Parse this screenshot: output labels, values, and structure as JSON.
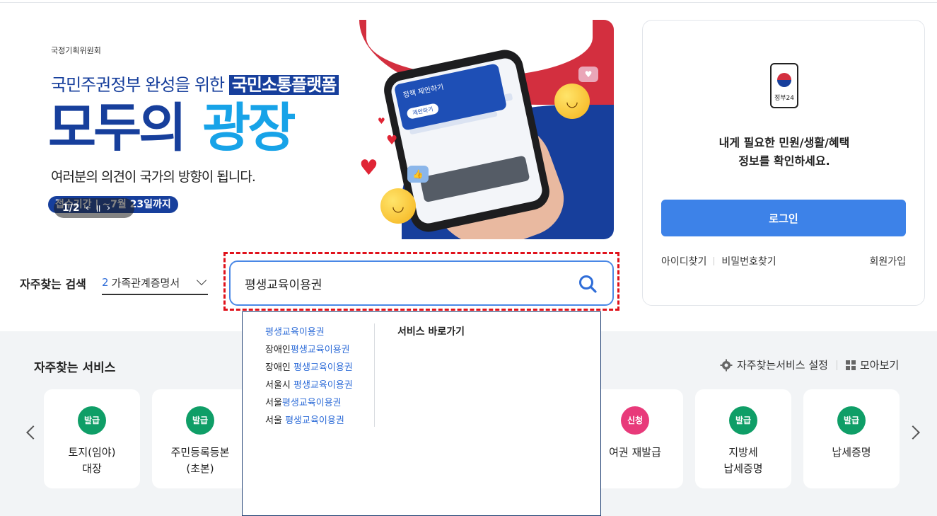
{
  "banner": {
    "org": "국정기획위원회",
    "line1_pre": "국민주권정부 완성을 위한 ",
    "line1_hl": "국민소통플랫폼",
    "big_a": "모두의",
    "big_b": "광장",
    "sub": "여러분의 의견이 국가의 방향이 됩니다.",
    "period": "접수기간 | ~7월 23일까지",
    "pager": "1/2",
    "card_title": "정책 제안하기",
    "card_button": "제안하기"
  },
  "login": {
    "logo_label": "정부24",
    "message_line1": "내게 필요한 민원/생활/혜택",
    "message_line2": "정보를 확인하세요.",
    "login_button": "로그인",
    "find_id": "아이디찾기",
    "find_pw": "비밀번호찾기",
    "signup": "회원가입"
  },
  "search": {
    "fav_label": "자주찾는 검색",
    "fav_rank": "2",
    "fav_term": "가족관계증명서",
    "query": "평생교육이용권"
  },
  "suggestions": {
    "items": [
      {
        "pre": "",
        "match": "평생교육이용권"
      },
      {
        "pre": "장애인",
        "match": "평생교육이용권"
      },
      {
        "pre": "장애인 ",
        "match": "평생교육이용권"
      },
      {
        "pre": "서울시 ",
        "match": "평생교육이용권"
      },
      {
        "pre": "서울",
        "match": "평생교육이용권"
      },
      {
        "pre": "서울 ",
        "match": "평생교육이용권"
      }
    ],
    "shortcut_title": "서비스 바로가기"
  },
  "services": {
    "title": "자주찾는 서비스",
    "settings": "자주찾는서비스 설정",
    "view_all": "모아보기",
    "cards": [
      {
        "badge": "발급",
        "name": "토지(임야)\n대장"
      },
      {
        "badge": "발급",
        "name": "주민등록등본\n(초본)"
      },
      {
        "badge": "신청",
        "name": "여권 재발급"
      },
      {
        "badge": "발급",
        "name": "지방세\n납세증명"
      },
      {
        "badge": "발급",
        "name": "납세증명"
      }
    ]
  },
  "colors": {
    "accent_blue": "#3d82e8",
    "badge_green": "#0f9e67",
    "badge_pink": "#e83a7a",
    "focus_red": "#e0111b"
  }
}
